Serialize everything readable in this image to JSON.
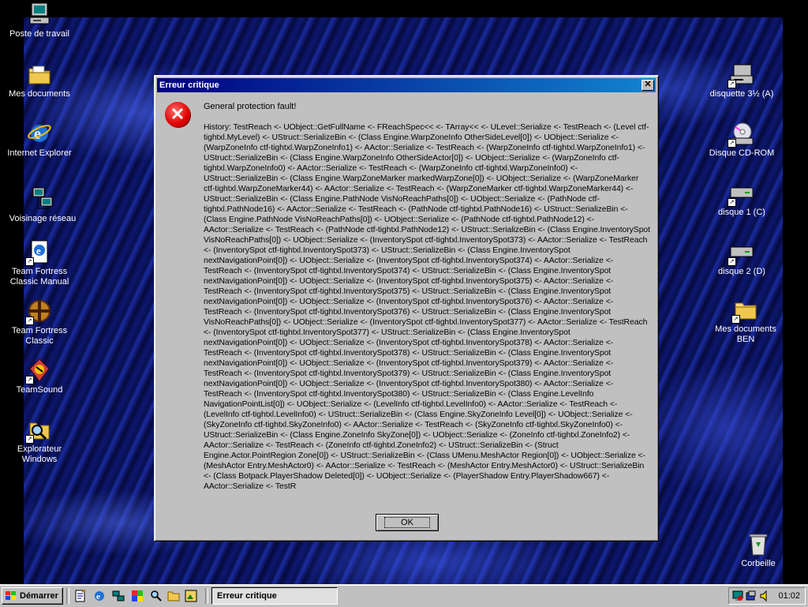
{
  "desktop": {
    "left_icons": [
      {
        "label": "Poste de travail",
        "icon": "computer-icon"
      },
      {
        "label": "Mes documents",
        "icon": "folder-documents-icon"
      },
      {
        "label": "Internet Explorer",
        "icon": "internet-explorer-icon"
      },
      {
        "label": "Voisinage réseau",
        "icon": "network-icon"
      },
      {
        "label": "Team Fortress Classic Manual",
        "icon": "help-document-icon"
      },
      {
        "label": "Team Fortress Classic",
        "icon": "tfc-icon"
      },
      {
        "label": "TeamSound",
        "icon": "teamsound-icon"
      },
      {
        "label": "Explorateur Windows",
        "icon": "explorer-icon"
      }
    ],
    "right_icons": [
      {
        "label": "disquette 3½ (A)",
        "icon": "floppy-drive-icon"
      },
      {
        "label": "Disque CD-ROM",
        "icon": "cdrom-icon"
      },
      {
        "label": "disque 1  (C)",
        "icon": "hard-drive-icon"
      },
      {
        "label": "disque 2 (D)",
        "icon": "hard-drive-icon"
      },
      {
        "label": "Mes documents BEN",
        "icon": "folder-icon"
      },
      {
        "label": "Corbeille",
        "icon": "recycle-bin-icon"
      }
    ]
  },
  "dialog": {
    "title": "Erreur critique",
    "close_glyph": "✕",
    "icon": "error-icon",
    "headline": "General protection fault!",
    "history": "History: TestReach <- UObject::GetFullName <- FReachSpec<< <- TArray<< <- ULevel::Serialize <- TestReach <- (Level ctf-tightxl.MyLevel) <- UStruct::SerializeBin <- (Class Engine.WarpZoneInfo OtherSideLevel[0]) <- UObject::Serialize <- (WarpZoneInfo ctf-tightxl.WarpZoneInfo1) <- AActor::Serialize <- TestReach <- (WarpZoneInfo ctf-tightxl.WarpZoneInfo1) <- UStruct::SerializeBin <- (Class Engine.WarpZoneInfo OtherSideActor[0]) <- UObject::Serialize <- (WarpZoneInfo ctf-tightxl.WarpZoneInfo0) <- AActor::Serialize <- TestReach <- (WarpZoneInfo ctf-tightxl.WarpZoneInfo0) <- UStruct::SerializeBin <- (Class Engine.WarpZoneMarker markedWarpZone[0]) <- UObject::Serialize <- (WarpZoneMarker ctf-tightxl.WarpZoneMarker44) <- AActor::Serialize <- TestReach <- (WarpZoneMarker ctf-tightxl.WarpZoneMarker44) <- UStruct::SerializeBin <- (Class Engine.PathNode VisNoReachPaths[0]) <- UObject::Serialize <- (PathNode ctf-tightxl.PathNode16) <- AActor::Serialize <- TestReach <- (PathNode ctf-tightxl.PathNode16) <- UStruct::SerializeBin <- (Class Engine.PathNode VisNoReachPaths[0]) <- UObject::Serialize <- (PathNode ctf-tightxl.PathNode12) <- AActor::Serialize <- TestReach <- (PathNode ctf-tightxl.PathNode12) <- UStruct::SerializeBin <- (Class Engine.InventorySpot VisNoReachPaths[0]) <- UObject::Serialize <- (InventorySpot ctf-tightxl.InventorySpot373) <- AActor::Serialize <- TestReach <- (InventorySpot ctf-tightxl.InventorySpot373) <- UStruct::SerializeBin <- (Class Engine.InventorySpot nextNavigationPoint[0]) <- UObject::Serialize <- (InventorySpot ctf-tightxl.InventorySpot374) <- AActor::Serialize <- TestReach <- (InventorySpot ctf-tightxl.InventorySpot374) <- UStruct::SerializeBin <- (Class Engine.InventorySpot nextNavigationPoint[0]) <- UObject::Serialize <- (InventorySpot ctf-tightxl.InventorySpot375) <- AActor::Serialize <- TestReach <- (InventorySpot ctf-tightxl.InventorySpot375) <- UStruct::SerializeBin <- (Class Engine.InventorySpot nextNavigationPoint[0]) <- UObject::Serialize <- (InventorySpot ctf-tightxl.InventorySpot376) <- AActor::Serialize <- TestReach <- (InventorySpot ctf-tightxl.InventorySpot376) <- UStruct::SerializeBin <- (Class Engine.InventorySpot VisNoReachPaths[0]) <- UObject::Serialize <- (InventorySpot ctf-tightxl.InventorySpot377) <- AActor::Serialize <- TestReach <- (InventorySpot ctf-tightxl.InventorySpot377) <- UStruct::SerializeBin <- (Class Engine.InventorySpot nextNavigationPoint[0]) <- UObject::Serialize <- (InventorySpot ctf-tightxl.InventorySpot378) <- AActor::Serialize <- TestReach <- (InventorySpot ctf-tightxl.InventorySpot378) <- UStruct::SerializeBin <- (Class Engine.InventorySpot nextNavigationPoint[0]) <- UObject::Serialize <- (InventorySpot ctf-tightxl.InventorySpot379) <- AActor::Serialize <- TestReach <- (InventorySpot ctf-tightxl.InventorySpot379) <- UStruct::SerializeBin <- (Class Engine.InventorySpot nextNavigationPoint[0]) <- UObject::Serialize <- (InventorySpot ctf-tightxl.InventorySpot380) <- AActor::Serialize <- TestReach <- (InventorySpot ctf-tightxl.InventorySpot380) <- UStruct::SerializeBin <- (Class Engine.LevelInfo NavigationPointList[0]) <- UObject::Serialize <- (LevelInfo ctf-tightxl.LevelInfo0) <- AActor::Serialize <- TestReach <- (LevelInfo ctf-tightxl.LevelInfo0) <- UStruct::SerializeBin <- (Class Engine.SkyZoneInfo Level[0]) <- UObject::Serialize <- (SkyZoneInfo ctf-tightxl.SkyZoneInfo0) <- AActor::Serialize <- TestReach <- (SkyZoneInfo ctf-tightxl.SkyZoneInfo0) <- UStruct::SerializeBin <- (Class Engine.ZoneInfo SkyZone[0]) <- UObject::Serialize <- (ZoneInfo ctf-tightxl.ZoneInfo2) <- AActor::Serialize <- TestReach <- (ZoneInfo ctf-tightxl.ZoneInfo2) <- UStruct::SerializeBin <- (Struct Engine.Actor.PointRegion Zone[0]) <- UStruct::SerializeBin <- (Class UMenu.MeshActor Region[0]) <- UObject::Serialize <- (MeshActor Entry.MeshActor0) <- AActor::Serialize <- TestReach <- (MeshActor Entry.MeshActor0) <- UStruct::SerializeBin <- (Class Botpack.PlayerShadow Deleted[0]) <- UObject::Serialize <- (PlayerShadow Entry.PlayerShadow667) <- AActor::Serialize <- TestR",
    "ok_label": "OK"
  },
  "taskbar": {
    "start_label": "Démarrer",
    "quicklaunch": [
      "notepad-icon",
      "internet-explorer-icon",
      "network-icon",
      "paint-icon",
      "search-icon",
      "folder-icon",
      "image-icon"
    ],
    "task_label": "Erreur critique",
    "tray_icons": [
      "display-icon",
      "audio-icon",
      "speaker-icon"
    ],
    "clock": "01:02"
  },
  "colors": {
    "title_start": "#000080",
    "title_end": "#1084d0",
    "face": "#c0c0c0",
    "error_red": "#e00000"
  }
}
